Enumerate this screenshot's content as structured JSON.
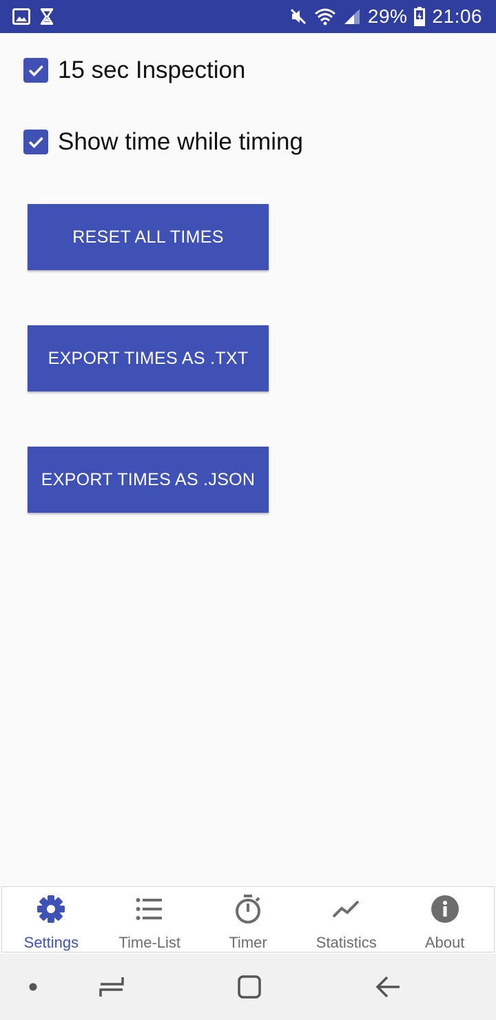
{
  "status_bar": {
    "battery": "29%",
    "time": "21:06",
    "left_icons": [
      "image-icon",
      "hourglass-icon"
    ],
    "right_icons": [
      "mute-icon",
      "wifi-icon",
      "signal-icon",
      "battery-icon"
    ]
  },
  "settings": {
    "inspection": {
      "label": "15 sec Inspection",
      "checked": true
    },
    "show_time": {
      "label": "Show time while timing",
      "checked": true
    }
  },
  "buttons": {
    "reset": "RESET ALL TIMES",
    "export_txt": "EXPORT TIMES AS .TXT",
    "export_json": "EXPORT TIMES AS .JSON"
  },
  "bottom_nav": {
    "items": [
      {
        "label": "Settings",
        "icon": "gear-icon",
        "active": true
      },
      {
        "label": "Time-List",
        "icon": "list-icon",
        "active": false
      },
      {
        "label": "Timer",
        "icon": "stopwatch-icon",
        "active": false
      },
      {
        "label": "Statistics",
        "icon": "trend-icon",
        "active": false
      },
      {
        "label": "About",
        "icon": "info-icon",
        "active": false
      }
    ]
  },
  "colors": {
    "primary": "#3f51b5",
    "status_bar": "#303f9f",
    "background": "#fafafa",
    "inactive": "#6d6d6d"
  }
}
